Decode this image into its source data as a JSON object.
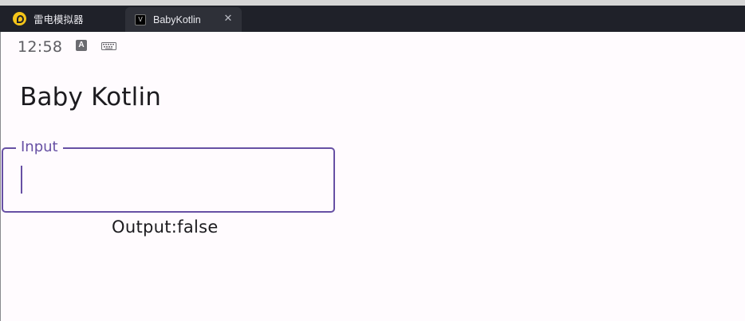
{
  "window": {
    "emulator_tab_label": "雷电模拟器",
    "app_tab_label": "BabyKotlin",
    "close_glyph": "✕"
  },
  "status_bar": {
    "time": "12:58",
    "a_badge": "A",
    "icons": [
      "a-icon",
      "keyboard-icon"
    ]
  },
  "app": {
    "title": "Baby Kotlin",
    "input_label": "Input",
    "input_value": "",
    "output_text": "Output:false"
  },
  "colors": {
    "accent": "#6750a4",
    "background": "#fffbfe",
    "chrome": "#1f2129"
  }
}
